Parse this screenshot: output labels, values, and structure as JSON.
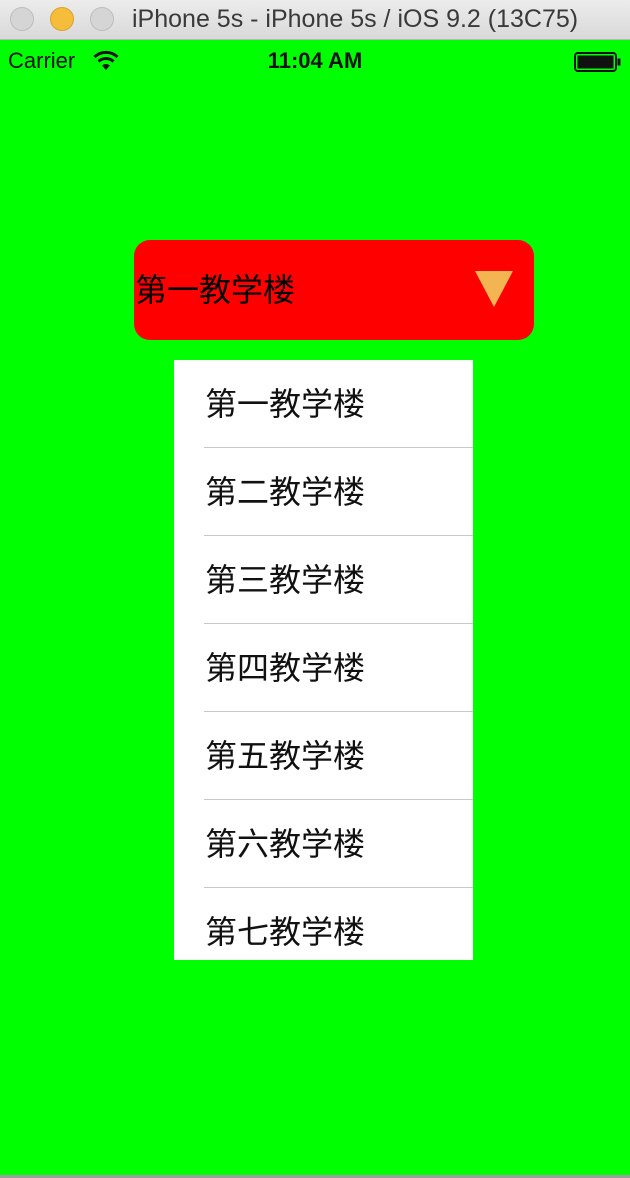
{
  "window": {
    "title": "iPhone 5s - iPhone 5s / iOS 9.2 (13C75)",
    "buttons": [
      "close",
      "minimize",
      "zoom"
    ]
  },
  "status_bar": {
    "carrier": "Carrier",
    "time": "11:04 AM",
    "icons": [
      "wifi-icon",
      "battery-icon"
    ]
  },
  "dropdown": {
    "selected_label": "第一教学楼",
    "arrow_icon": "triangle-down-icon",
    "colors": {
      "background": "#00ff00",
      "button": "#ff0000",
      "arrow": "#f2b552",
      "list": "#ffffff"
    },
    "options": [
      "第一教学楼",
      "第二教学楼",
      "第三教学楼",
      "第四教学楼",
      "第五教学楼",
      "第六教学楼",
      "第七教学楼"
    ]
  }
}
